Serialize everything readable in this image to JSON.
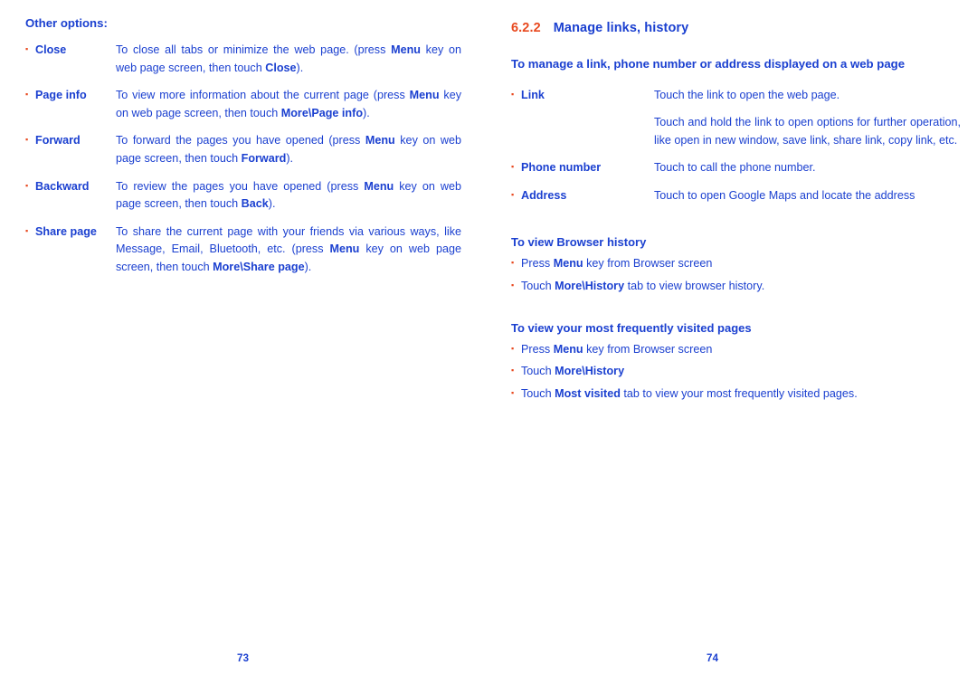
{
  "colors": {
    "text_blue": "#1b40d0",
    "accent_orange": "#e8491f"
  },
  "left_page": {
    "number": "73",
    "heading": "Other options:",
    "bullet_glyph": "▪",
    "rows": [
      {
        "term": "Close",
        "paragraphs": [
          "To close all tabs or minimize the web page. (press <b>Menu</b> key on web page screen, then touch <b>Close</b>)."
        ]
      },
      {
        "term": "Page info",
        "paragraphs": [
          "To view more information about the current page (press <b>Menu</b> key on web page screen, then touch <b>More\\Page info</b>)."
        ]
      },
      {
        "term": "Forward",
        "paragraphs": [
          "To forward the pages you have opened (press <b>Menu</b> key on web page screen, then touch <b>Forward</b>)."
        ]
      },
      {
        "term": "Backward",
        "paragraphs": [
          "To review the pages you have opened (press <b>Menu</b> key on web page screen, then touch <b>Back</b>)."
        ]
      },
      {
        "term": "Share page",
        "paragraphs": [
          "To share the current page with your friends via various ways, like Message, Email, Bluetooth, etc. (press <b>Menu</b> key on web page screen, then touch <b>More\\Share page</b>)."
        ]
      }
    ]
  },
  "right_page": {
    "number": "74",
    "section_number": "6.2.2",
    "section_title": "Manage links, history",
    "intro_heading": "To manage a link, phone number or address displayed on a web page",
    "bullet_glyph": "▪",
    "rows": [
      {
        "term": "Link",
        "paragraphs": [
          "Touch the link to open the web page.",
          "Touch and hold the link to open options for further operation, like open in new window, save link, share link, copy link, etc."
        ]
      },
      {
        "term": "Phone number",
        "paragraphs": [
          "Touch to call the phone number."
        ]
      },
      {
        "term": "Address",
        "paragraphs": [
          "Touch to open Google Maps and locate the address"
        ]
      }
    ],
    "history_section": {
      "heading": "To view Browser history",
      "items": [
        "Press <b>Menu</b> key from Browser screen",
        "Touch <b>More\\History</b> tab to view browser history."
      ]
    },
    "most_visited_section": {
      "heading": "To view your most frequently visited pages",
      "items": [
        "Press <b>Menu</b> key from Browser screen",
        "Touch <b>More\\History</b>",
        "Touch <b>Most visited</b> tab to view your most frequently visited pages."
      ]
    }
  }
}
